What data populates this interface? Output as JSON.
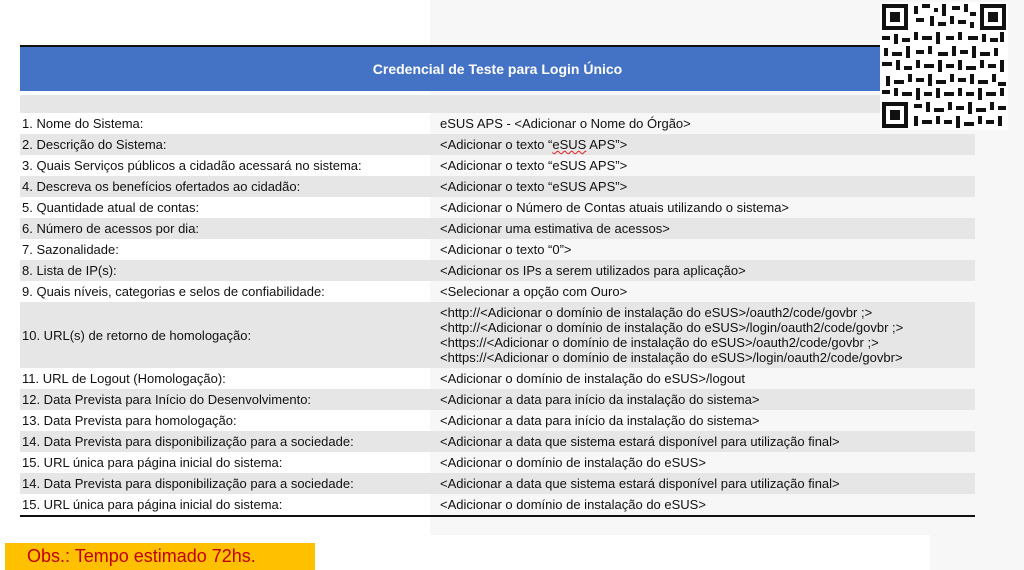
{
  "header": {
    "title": "Credencial de Teste para Login Único"
  },
  "rows": [
    {
      "label": "1. Nome do Sistema:",
      "value": "eSUS APS - <Adicionar o Nome do Órgão>"
    },
    {
      "label": "2. Descrição do Sistema:",
      "value_pre": "<Adicionar o texto “",
      "value_mark": "eSUS",
      "value_post": " APS”>"
    },
    {
      "label": "3. Quais Serviços públicos a cidadão acessará no sistema:",
      "value": "<Adicionar o texto “eSUS APS”>"
    },
    {
      "label": "4. Descreva os benefícios ofertados ao cidadão:",
      "value": "<Adicionar o texto “eSUS APS”>"
    },
    {
      "label": "5. Quantidade atual de contas:",
      "value": "<Adicionar o Número de Contas atuais utilizando o sistema>"
    },
    {
      "label": "6. Número de acessos por dia:",
      "value": "<Adicionar uma estimativa de acessos>"
    },
    {
      "label": "7. Sazonalidade:",
      "value": "<Adicionar o texto “0”>"
    },
    {
      "label": "8. Lista de IP(s):",
      "value": "<Adicionar os IPs a serem utilizados para aplicação>"
    },
    {
      "label": "9. Quais níveis, categorias e selos de confiabilidade:",
      "value": "<Selecionar a opção com Ouro>"
    },
    {
      "label": "10. URL(s) de retorno de homologação:",
      "lines": [
        "<http://<Adicionar o domínio de instalação do eSUS>/oauth2/code/govbr ;>",
        "<http://<Adicionar o domínio de instalação do eSUS>/login/oauth2/code/govbr ;>",
        "<https://<Adicionar o domínio de instalação do eSUS>/oauth2/code/govbr ;>",
        "<https://<Adicionar o domínio de instalação do eSUS>/login/oauth2/code/govbr>"
      ]
    },
    {
      "label": "11. URL de Logout (Homologação):",
      "value": "<Adicionar o domínio de instalação do eSUS>/logout"
    },
    {
      "label": "12. Data Prevista para Início do Desenvolvimento:",
      "value": "<Adicionar a data para início da instalação do sistema>"
    },
    {
      "label": "13. Data Prevista para homologação:",
      "value": "<Adicionar a data para início da instalação do sistema>"
    },
    {
      "label": "14. Data Prevista para disponibilização para a sociedade:",
      "value": "<Adicionar a data que sistema estará disponível para utilização final>"
    },
    {
      "label": "15. URL única para página inicial do sistema:",
      "value": "<Adicionar o domínio de instalação do eSUS>"
    },
    {
      "label": "14. Data Prevista para disponibilização para a sociedade:",
      "value": "<Adicionar a data que sistema estará disponível para utilização final>"
    },
    {
      "label": "15. URL única para página inicial do sistema:",
      "value": "<Adicionar o domínio de instalação do eSUS>"
    }
  ],
  "note": {
    "text": "Obs.: Tempo estimado 72hs.",
    "bg": "#ffc000",
    "color": "#c00000"
  },
  "colors": {
    "header_bg": "#4472c4",
    "row_shade": "#e6e6e6"
  }
}
